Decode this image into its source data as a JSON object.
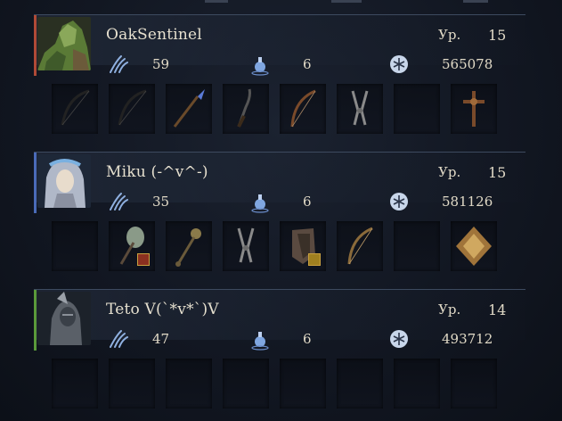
{
  "level_label": "Ур.",
  "players": [
    {
      "name": "OakSentinel",
      "level": "15",
      "vigor": "59",
      "flask": "6",
      "runes": "565078",
      "accent": "#b04a36",
      "slots": [
        "bow",
        "bow",
        "spear",
        "sickle",
        "longbow",
        "crossbow-pliers",
        "empty",
        "cross-talisman"
      ]
    },
    {
      "name": "Miku (-^v^-)",
      "level": "15",
      "vigor": "35",
      "flask": "6",
      "runes": "581126",
      "accent": "#4a6bb8",
      "slots": [
        "empty",
        "leaf-axe",
        "mace",
        "crossbow-pliers",
        "shield",
        "longbow",
        "empty",
        "gold-rune"
      ]
    },
    {
      "name": "Teto V(`*v*`)V",
      "level": "14",
      "vigor": "47",
      "flask": "6",
      "runes": "493712",
      "accent": "#5a9a3a",
      "slots": [
        "empty",
        "empty",
        "empty",
        "empty",
        "empty",
        "empty",
        "empty",
        "empty"
      ]
    }
  ]
}
